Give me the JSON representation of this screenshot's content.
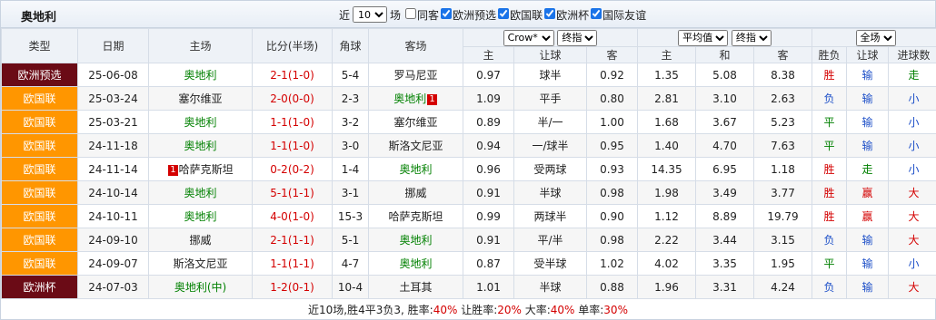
{
  "team_title": "奥地利",
  "filters": {
    "near_label": "近",
    "count_value": "10",
    "count_options": [
      "10"
    ],
    "unit_label": "场",
    "checkboxes": [
      {
        "label": "同客",
        "checked": false
      },
      {
        "label": "欧洲预选",
        "checked": true
      },
      {
        "label": "欧国联",
        "checked": true
      },
      {
        "label": "欧洲杯",
        "checked": true
      },
      {
        "label": "国际友谊",
        "checked": true
      }
    ]
  },
  "headers": {
    "type": "类型",
    "date": "日期",
    "home": "主场",
    "score": "比分(半场)",
    "corner": "角球",
    "away": "客场",
    "company_select": "Crow*",
    "handicap_select": "终指",
    "avg_select": "平均值",
    "euro_final_select": "终指",
    "scope_select": "全场",
    "h_home": "主",
    "h_handicap": "让球",
    "h_away": "客",
    "e_home": "主",
    "e_draw": "和",
    "e_away": "客",
    "result": "胜负",
    "hc_result": "让球",
    "ou_result": "进球数"
  },
  "rows": [
    {
      "type": "欧洲预选",
      "type_class": "euq",
      "date": "25-06-08",
      "home": "奥地利",
      "home_cls": "green",
      "home_badge": "",
      "score": "2-1",
      "half": "(1-0)",
      "corner": "5-4",
      "away": "罗马尼亚",
      "away_cls": "",
      "away_badge": "",
      "hh": "0.97",
      "hc": "球半",
      "ha": "0.92",
      "eh": "1.35",
      "ed": "5.08",
      "ea": "8.38",
      "res": "胜",
      "res_cls": "res-win",
      "hcr": "输",
      "hcr_cls": "hc-loss",
      "ou": "走",
      "ou_cls": "ou-push"
    },
    {
      "type": "欧国联",
      "type_class": "nl",
      "date": "25-03-24",
      "home": "塞尔维亚",
      "home_cls": "",
      "home_badge": "",
      "score": "2-0",
      "half": "(0-0)",
      "corner": "2-3",
      "away": "奥地利",
      "away_cls": "green",
      "away_badge": "1",
      "hh": "1.09",
      "hc": "平手",
      "ha": "0.80",
      "eh": "2.81",
      "ed": "3.10",
      "ea": "2.63",
      "res": "负",
      "res_cls": "res-loss",
      "hcr": "输",
      "hcr_cls": "hc-loss",
      "ou": "小",
      "ou_cls": "ou-small"
    },
    {
      "type": "欧国联",
      "type_class": "nl",
      "date": "25-03-21",
      "home": "奥地利",
      "home_cls": "green",
      "home_badge": "",
      "score": "1-1",
      "half": "(1-0)",
      "corner": "3-2",
      "away": "塞尔维亚",
      "away_cls": "",
      "away_badge": "",
      "hh": "0.89",
      "hc": "半/一",
      "ha": "1.00",
      "eh": "1.68",
      "ed": "3.67",
      "ea": "5.23",
      "res": "平",
      "res_cls": "res-draw",
      "hcr": "输",
      "hcr_cls": "hc-loss",
      "ou": "小",
      "ou_cls": "ou-small"
    },
    {
      "type": "欧国联",
      "type_class": "nl",
      "date": "24-11-18",
      "home": "奥地利",
      "home_cls": "green",
      "home_badge": "",
      "score": "1-1",
      "half": "(1-0)",
      "corner": "3-0",
      "away": "斯洛文尼亚",
      "away_cls": "",
      "away_badge": "",
      "hh": "0.94",
      "hc": "一/球半",
      "ha": "0.95",
      "eh": "1.40",
      "ed": "4.70",
      "ea": "7.63",
      "res": "平",
      "res_cls": "res-draw",
      "hcr": "输",
      "hcr_cls": "hc-loss",
      "ou": "小",
      "ou_cls": "ou-small"
    },
    {
      "type": "欧国联",
      "type_class": "nl",
      "date": "24-11-14",
      "home": "哈萨克斯坦",
      "home_cls": "",
      "home_badge": "1",
      "score": "0-2",
      "half": "(0-2)",
      "corner": "1-4",
      "away": "奥地利",
      "away_cls": "green",
      "away_badge": "",
      "hh": "0.96",
      "hc": "受两球",
      "ha": "0.93",
      "eh": "14.35",
      "ed": "6.95",
      "ea": "1.18",
      "res": "胜",
      "res_cls": "res-win",
      "hcr": "走",
      "hcr_cls": "hc-push",
      "ou": "小",
      "ou_cls": "ou-small"
    },
    {
      "type": "欧国联",
      "type_class": "nl",
      "date": "24-10-14",
      "home": "奥地利",
      "home_cls": "green",
      "home_badge": "",
      "score": "5-1",
      "half": "(1-1)",
      "corner": "3-1",
      "away": "挪威",
      "away_cls": "",
      "away_badge": "",
      "hh": "0.91",
      "hc": "半球",
      "ha": "0.98",
      "eh": "1.98",
      "ed": "3.49",
      "ea": "3.77",
      "res": "胜",
      "res_cls": "res-win",
      "hcr": "赢",
      "hcr_cls": "hc-win",
      "ou": "大",
      "ou_cls": "ou-big"
    },
    {
      "type": "欧国联",
      "type_class": "nl",
      "date": "24-10-11",
      "home": "奥地利",
      "home_cls": "green",
      "home_badge": "",
      "score": "4-0",
      "half": "(1-0)",
      "corner": "15-3",
      "away": "哈萨克斯坦",
      "away_cls": "",
      "away_badge": "",
      "hh": "0.99",
      "hc": "两球半",
      "ha": "0.90",
      "eh": "1.12",
      "ed": "8.89",
      "ea": "19.79",
      "res": "胜",
      "res_cls": "res-win",
      "hcr": "赢",
      "hcr_cls": "hc-win",
      "ou": "大",
      "ou_cls": "ou-big"
    },
    {
      "type": "欧国联",
      "type_class": "nl",
      "date": "24-09-10",
      "home": "挪威",
      "home_cls": "",
      "home_badge": "",
      "score": "2-1",
      "half": "(1-1)",
      "corner": "5-1",
      "away": "奥地利",
      "away_cls": "green",
      "away_badge": "",
      "hh": "0.91",
      "hc": "平/半",
      "ha": "0.98",
      "eh": "2.22",
      "ed": "3.44",
      "ea": "3.15",
      "res": "负",
      "res_cls": "res-loss",
      "hcr": "输",
      "hcr_cls": "hc-loss",
      "ou": "大",
      "ou_cls": "ou-big"
    },
    {
      "type": "欧国联",
      "type_class": "nl",
      "date": "24-09-07",
      "home": "斯洛文尼亚",
      "home_cls": "",
      "home_badge": "",
      "score": "1-1",
      "half": "(1-1)",
      "corner": "4-7",
      "away": "奥地利",
      "away_cls": "green",
      "away_badge": "",
      "hh": "0.87",
      "hc": "受半球",
      "ha": "1.02",
      "eh": "4.02",
      "ed": "3.35",
      "ea": "1.95",
      "res": "平",
      "res_cls": "res-draw",
      "hcr": "输",
      "hcr_cls": "hc-loss",
      "ou": "小",
      "ou_cls": "ou-small"
    },
    {
      "type": "欧洲杯",
      "type_class": "ec",
      "date": "24-07-03",
      "home": "奥地利(中)",
      "home_cls": "green",
      "home_badge": "",
      "score": "1-2",
      "half": "(0-1)",
      "corner": "10-4",
      "away": "土耳其",
      "away_cls": "",
      "away_badge": "",
      "hh": "1.01",
      "hc": "半球",
      "ha": "0.88",
      "eh": "1.96",
      "ed": "3.31",
      "ea": "4.24",
      "res": "负",
      "res_cls": "res-loss",
      "hcr": "输",
      "hcr_cls": "hc-loss",
      "ou": "大",
      "ou_cls": "ou-big"
    }
  ],
  "summary": {
    "prefix": "近10场,胜4平3负3, 胜率:",
    "win_rate": "40%",
    "hc_label": " 让胜率:",
    "hc_rate": "20%",
    "big_label": " 大率:",
    "big_rate": "40%",
    "odd_label": " 单率:",
    "odd_rate": "30%"
  },
  "colors": {
    "type_euro_qual": "#6b0b16",
    "type_nations_league": "#ff9600",
    "type_euro_cup": "#6b0b16",
    "team_highlight": "#008000",
    "score_red": "#d40000"
  }
}
